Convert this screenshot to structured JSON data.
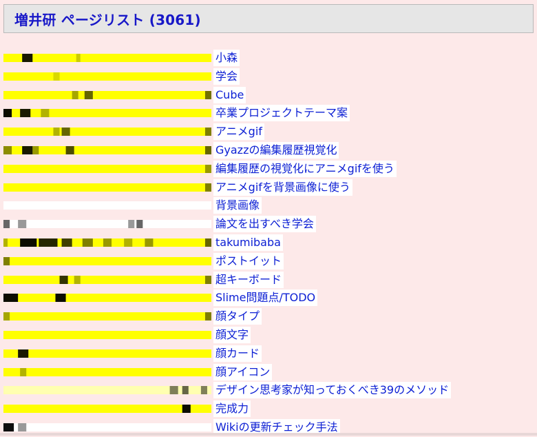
{
  "header": {
    "title": "増井研 ページリスト (3061)"
  },
  "colors": {
    "page_background": "#fde9e9",
    "header_background": "#e6e6e6",
    "link": "#0d20d4",
    "bar_bright": "#ffff00",
    "bar_pale": "#ffffb0",
    "bar_empty": "#ffffff"
  },
  "pages": [
    {
      "title": "小森",
      "bar": {
        "color": "#ffff00",
        "marks": [
          [
            0.09,
            0.05,
            0.9
          ],
          [
            0.35,
            0.02,
            0.2
          ]
        ]
      }
    },
    {
      "title": "学会",
      "bar": {
        "color": "#ffff00",
        "marks": [
          [
            0.24,
            0.03,
            0.15
          ]
        ]
      }
    },
    {
      "title": "Cube",
      "bar": {
        "color": "#ffff00",
        "marks": [
          [
            0.33,
            0.03,
            0.35
          ],
          [
            0.39,
            0.04,
            0.6
          ],
          [
            0.97,
            0.03,
            0.55
          ]
        ]
      }
    },
    {
      "title": "卒業プロジェクトテーマ案",
      "bar": {
        "color": "#ffff00",
        "marks": [
          [
            0.0,
            0.04,
            0.95
          ],
          [
            0.08,
            0.05,
            0.9
          ],
          [
            0.18,
            0.04,
            0.3
          ]
        ]
      }
    },
    {
      "title": "アニメgif",
      "bar": {
        "color": "#ffff00",
        "marks": [
          [
            0.24,
            0.03,
            0.3
          ],
          [
            0.28,
            0.04,
            0.6
          ],
          [
            0.97,
            0.03,
            0.5
          ]
        ]
      }
    },
    {
      "title": "Gyazzの編集履歴視覚化",
      "bar": {
        "color": "#ffff00",
        "marks": [
          [
            0.0,
            0.04,
            0.45
          ],
          [
            0.09,
            0.05,
            0.9
          ],
          [
            0.14,
            0.03,
            0.4
          ],
          [
            0.3,
            0.04,
            0.7
          ],
          [
            0.97,
            0.03,
            0.6
          ]
        ]
      }
    },
    {
      "title": "編集履歴の視覚化にアニメgifを使う",
      "bar": {
        "color": "#ffff00",
        "marks": [
          [
            0.97,
            0.03,
            0.4
          ]
        ]
      }
    },
    {
      "title": "アニメgifを背景画像に使う",
      "bar": {
        "color": "#ffff00",
        "marks": [
          [
            0.97,
            0.03,
            0.5
          ]
        ]
      }
    },
    {
      "title": "背景画像",
      "bar": {
        "color": "#ffffff",
        "marks": []
      }
    },
    {
      "title": "論文を出すべき学会",
      "bar": {
        "color": "#ffffff",
        "marks": [
          [
            0.0,
            0.03,
            0.6
          ],
          [
            0.07,
            0.04,
            0.4
          ],
          [
            0.6,
            0.03,
            0.4
          ],
          [
            0.64,
            0.03,
            0.6
          ]
        ]
      }
    },
    {
      "title": "takumibaba",
      "bar": {
        "color": "#ffff00",
        "marks": [
          [
            0.0,
            0.02,
            0.3
          ],
          [
            0.08,
            0.08,
            0.95
          ],
          [
            0.17,
            0.09,
            0.85
          ],
          [
            0.28,
            0.05,
            0.75
          ],
          [
            0.38,
            0.05,
            0.5
          ],
          [
            0.48,
            0.04,
            0.4
          ],
          [
            0.58,
            0.04,
            0.3
          ],
          [
            0.68,
            0.04,
            0.4
          ],
          [
            0.97,
            0.03,
            0.6
          ]
        ]
      }
    },
    {
      "title": "ポストイット",
      "bar": {
        "color": "#ffff00",
        "marks": [
          [
            0.0,
            0.03,
            0.5
          ]
        ]
      }
    },
    {
      "title": "超キーボード",
      "bar": {
        "color": "#ffff00",
        "marks": [
          [
            0.27,
            0.04,
            0.8
          ],
          [
            0.34,
            0.03,
            0.3
          ],
          [
            0.97,
            0.03,
            0.5
          ]
        ]
      }
    },
    {
      "title": "Slime問題点/TODO",
      "bar": {
        "color": "#ffff00",
        "marks": [
          [
            0.0,
            0.07,
            0.95
          ],
          [
            0.25,
            0.05,
            0.95
          ]
        ]
      }
    },
    {
      "title": "顔タイプ",
      "bar": {
        "color": "#ffff00",
        "marks": [
          [
            0.0,
            0.03,
            0.35
          ],
          [
            0.97,
            0.03,
            0.5
          ]
        ]
      }
    },
    {
      "title": "顔文字",
      "bar": {
        "color": "#ffff00",
        "marks": []
      }
    },
    {
      "title": "顔カード",
      "bar": {
        "color": "#ffff00",
        "marks": [
          [
            0.07,
            0.05,
            0.9
          ]
        ]
      }
    },
    {
      "title": "顔アイコン",
      "bar": {
        "color": "#ffff00",
        "marks": [
          [
            0.08,
            0.03,
            0.3
          ]
        ]
      }
    },
    {
      "title": "デザイン思考家が知っておくべき39のメソッド",
      "bar": {
        "color": "#ffffb0",
        "marks": [
          [
            0.8,
            0.04,
            0.5
          ],
          [
            0.86,
            0.03,
            0.6
          ],
          [
            0.95,
            0.03,
            0.5
          ]
        ]
      }
    },
    {
      "title": "完成力",
      "bar": {
        "color": "#ffff00",
        "marks": [
          [
            0.86,
            0.04,
            0.95
          ]
        ]
      }
    },
    {
      "title": "Wikiの更新チェック手法",
      "bar": {
        "color": "#ffffff",
        "marks": [
          [
            0.0,
            0.05,
            0.95
          ],
          [
            0.07,
            0.04,
            0.4
          ]
        ]
      }
    }
  ]
}
